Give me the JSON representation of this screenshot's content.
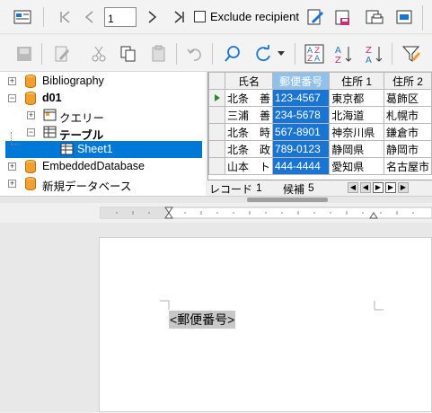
{
  "toolbar1": {
    "record_value": "1",
    "exclude_label": "Exclude recipient"
  },
  "tree": {
    "items": [
      {
        "label": "Bibliography"
      },
      {
        "label": "d01"
      },
      {
        "label": "クエリー"
      },
      {
        "label": "テーブル"
      },
      {
        "label": "Sheet1"
      },
      {
        "label": "EmbeddedDatabase"
      },
      {
        "label": "新規データベース"
      }
    ]
  },
  "grid": {
    "columns": [
      "氏名",
      "郵便番号",
      "住所 1",
      "住所 2"
    ],
    "rows": [
      [
        "北条　善",
        "123-4567",
        "東京都",
        "葛飾区"
      ],
      [
        "三浦　善",
        "234-5678",
        "北海道",
        "札幌市"
      ],
      [
        "北条　時",
        "567-8901",
        "神奈川県",
        "鎌倉市"
      ],
      [
        "北条　政",
        "789-0123",
        "静岡県",
        "静岡市"
      ],
      [
        "山本　ト",
        "444-4444",
        "愛知県",
        "名古屋市"
      ]
    ]
  },
  "navbar": {
    "record_label": "レコード",
    "record_num": "1",
    "candidate_label": "候補",
    "candidate_num": "5"
  },
  "document": {
    "field_text": "<郵便番号>"
  },
  "colors": {
    "selection": "#0078d7",
    "column_highlight": "#1a74d2",
    "db_icon": "#f0a030"
  }
}
